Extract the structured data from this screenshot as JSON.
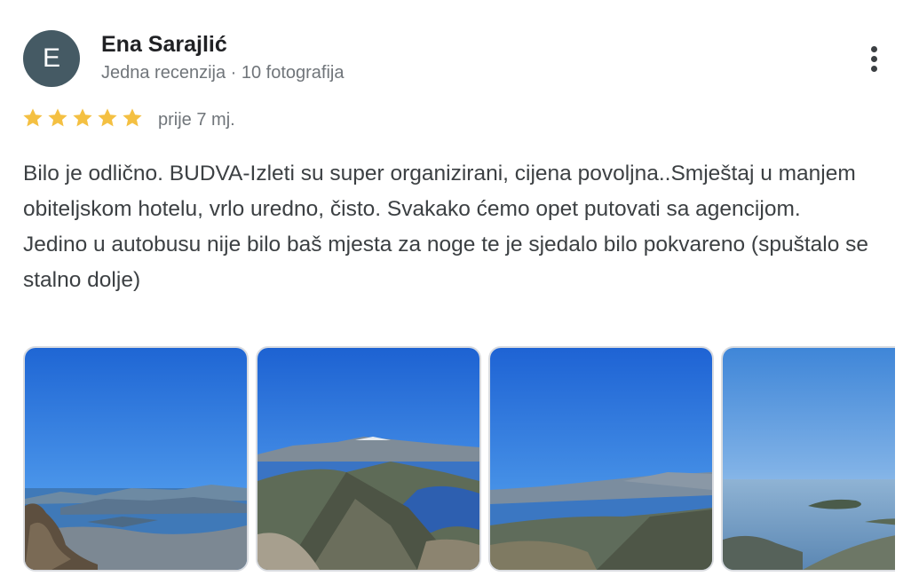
{
  "review": {
    "author_initial": "E",
    "author_name": "Ena Sarajlić",
    "author_meta": "Jedna recenzija · 10 fotografija",
    "rating": 5,
    "date": "prije 7 mj.",
    "text": "Bilo je odlično. BUDVA-Izleti su super organizirani, cijena povoljna..Smještaj u manjem obiteljskom hotelu, vrlo uredno, čisto. Svakako ćemo opet putovati sa agencijom.\nJedino u autobusu nije bilo baš mjesta za noge te je sjedalo bilo pokvareno (spuštalo se stalno dolje)"
  },
  "colors": {
    "avatar": "#455a64",
    "star": "#f4c042",
    "meta_text": "#70757a"
  },
  "icons": {
    "more": "more-vertical-icon",
    "star": "star-icon"
  }
}
